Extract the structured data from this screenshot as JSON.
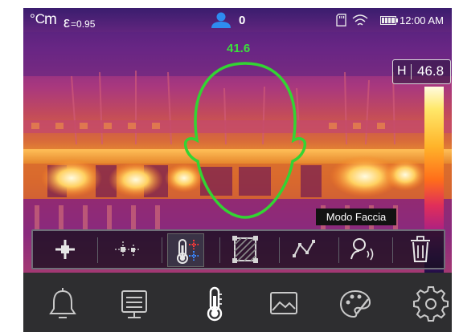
{
  "status_bar": {
    "unit": "°C",
    "mode": "m",
    "emissivity": "=0.95",
    "emissivity_symbol": "ε",
    "face_count": "0",
    "time": "12:00 AM",
    "icons": [
      "user-icon",
      "sd-card-icon",
      "wifi-icon",
      "battery-icon"
    ]
  },
  "face_detection": {
    "temperature": "41.6",
    "outline_color": "#33d433"
  },
  "scale": {
    "label": "H",
    "value": "46.8"
  },
  "tooltip": "Modo Faccia",
  "toolbar": {
    "items": [
      {
        "name": "center-point-icon"
      },
      {
        "name": "multi-point-icon"
      },
      {
        "name": "temperature-color-icon"
      },
      {
        "name": "area-box-icon"
      },
      {
        "name": "line-icon"
      },
      {
        "name": "face-mode-icon"
      },
      {
        "name": "trash-icon"
      }
    ]
  },
  "bottom_nav": {
    "items": [
      {
        "name": "bell-icon"
      },
      {
        "name": "monitor-icon"
      },
      {
        "name": "thermometer-icon",
        "active": true
      },
      {
        "name": "image-icon"
      },
      {
        "name": "palette-icon"
      },
      {
        "name": "settings-icon"
      }
    ]
  },
  "colors": {
    "face_green": "#33d433",
    "toolbar_bg": "#1c1424",
    "nav_bg": "#2e2e30",
    "icon_gray": "#c9c9c9",
    "accent_blue": "#2e8cf0"
  }
}
